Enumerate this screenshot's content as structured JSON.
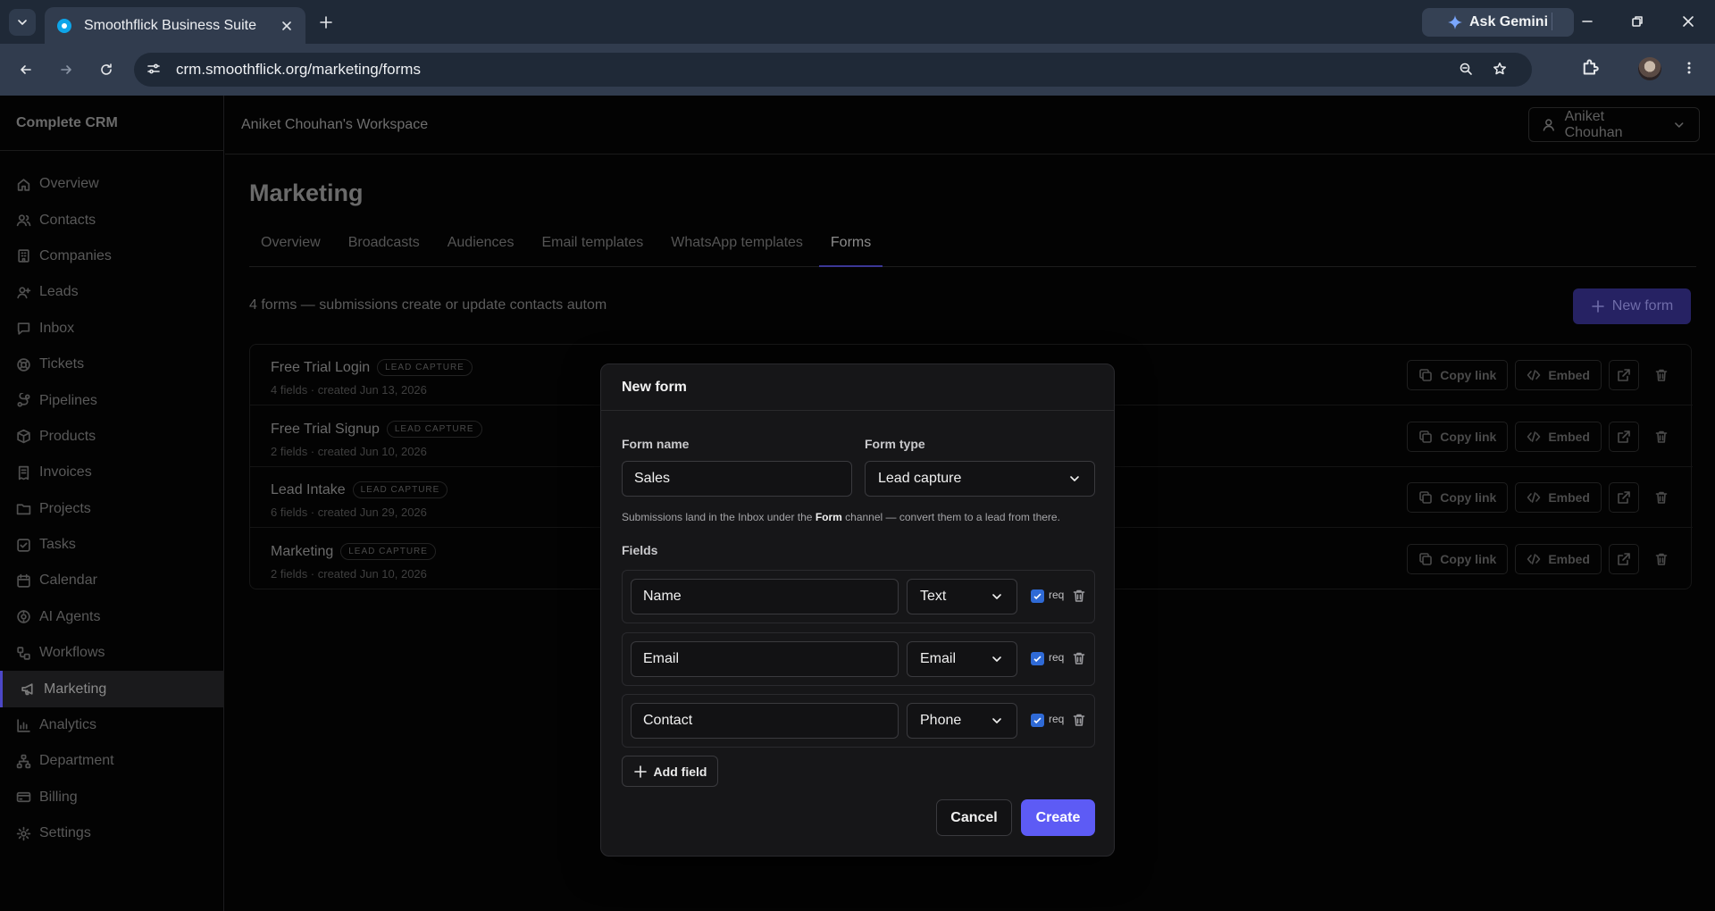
{
  "browser": {
    "tab_title": "Smoothflick Business Suite",
    "gemini_label": "Ask Gemini",
    "url": "crm.smoothflick.org/marketing/forms"
  },
  "app": {
    "brand": "Complete CRM",
    "workspace": "Aniket Chouhan's Workspace",
    "user_name": "Aniket Chouhan",
    "sidebar": [
      {
        "label": "Overview",
        "icon": "home-icon"
      },
      {
        "label": "Contacts",
        "icon": "users-icon"
      },
      {
        "label": "Companies",
        "icon": "building-icon"
      },
      {
        "label": "Leads",
        "icon": "user-plus-icon"
      },
      {
        "label": "Inbox",
        "icon": "message-icon"
      },
      {
        "label": "Tickets",
        "icon": "lifebuoy-icon"
      },
      {
        "label": "Pipelines",
        "icon": "pipeline-icon"
      },
      {
        "label": "Products",
        "icon": "package-icon"
      },
      {
        "label": "Invoices",
        "icon": "receipt-icon"
      },
      {
        "label": "Projects",
        "icon": "folder-icon"
      },
      {
        "label": "Tasks",
        "icon": "check-square-icon"
      },
      {
        "label": "Calendar",
        "icon": "calendar-icon"
      },
      {
        "label": "AI Agents",
        "icon": "bot-icon"
      },
      {
        "label": "Workflows",
        "icon": "workflow-icon"
      },
      {
        "label": "Marketing",
        "icon": "megaphone-icon",
        "active": true
      },
      {
        "label": "Analytics",
        "icon": "bar-chart-icon"
      },
      {
        "label": "Department",
        "icon": "network-icon"
      },
      {
        "label": "Billing",
        "icon": "credit-card-icon"
      },
      {
        "label": "Settings",
        "icon": "gear-icon"
      }
    ]
  },
  "marketing": {
    "title": "Marketing",
    "tabs": [
      "Overview",
      "Broadcasts",
      "Audiences",
      "Email templates",
      "WhatsApp templates",
      "Forms"
    ],
    "active_tab": "Forms",
    "subhead": "4 forms — submissions create or update contacts autom",
    "new_form_label": "New form",
    "forms": [
      {
        "name": "Free Trial Login",
        "badge": "LEAD CAPTURE",
        "meta": "4 fields · created Jun 13, 2026"
      },
      {
        "name": "Free Trial Signup",
        "badge": "LEAD CAPTURE",
        "meta": "2 fields · created Jun 10, 2026"
      },
      {
        "name": "Lead Intake",
        "badge": "LEAD CAPTURE",
        "meta": "6 fields · created Jun 29, 2026"
      },
      {
        "name": "Marketing",
        "badge": "LEAD CAPTURE",
        "meta": "2 fields · created Jun 10, 2026"
      }
    ],
    "row_actions": {
      "copy_link": "Copy link",
      "embed": "Embed"
    }
  },
  "modal": {
    "title": "New form",
    "form_name_label": "Form name",
    "form_name_value": "Sales",
    "form_type_label": "Form type",
    "form_type_value": "Lead capture",
    "hint_before": "Submissions land in the Inbox under the ",
    "hint_bold": "Form",
    "hint_after": " channel — convert them to a lead from there.",
    "fields_label": "Fields",
    "fields": [
      {
        "name": "Name",
        "type": "Text",
        "required": true,
        "req_label": "req"
      },
      {
        "name": "Email",
        "type": "Email",
        "required": true,
        "req_label": "req"
      },
      {
        "name": "Contact",
        "type": "Phone",
        "required": true,
        "req_label": "req"
      }
    ],
    "add_field_label": "Add field",
    "cancel_label": "Cancel",
    "create_label": "Create"
  },
  "colors": {
    "accent": "#5d5bf5",
    "checkbox": "#2f6ad6",
    "chrome_bg": "#1f2937"
  }
}
